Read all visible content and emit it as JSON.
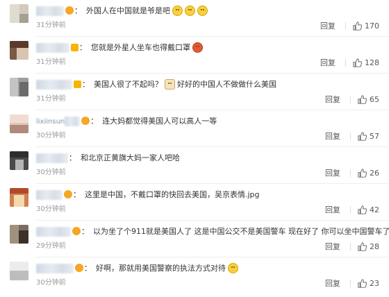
{
  "labels": {
    "reply": "回复"
  },
  "comments": [
    {
      "text": "外国人在中国就是爷是吧",
      "emojis": [
        "smile-emoji",
        "smile-emoji",
        "smile-emoji"
      ],
      "time": "31分钟前",
      "likes": "170",
      "avatar_colors": [
        "#c9c2b4",
        "#e0dbd1",
        "#a79f92"
      ]
    },
    {
      "text": "您就是外星人坐车也得戴口罩",
      "emojis": [
        "mask-emoji"
      ],
      "time": "31分钟前",
      "likes": "128",
      "avatar_colors": [
        "#5a3a2a",
        "#9a6a4a",
        "#d9c4b0"
      ]
    },
    {
      "text": "美国人很了不起吗？",
      "emojis": [
        "cat-emoji"
      ],
      "text2": "好好的中国人不做做什么美国",
      "time": "31分钟前",
      "likes": "65",
      "avatar_colors": [
        "#8e8e8e",
        "#c4c4c4",
        "#6b6b6b"
      ]
    },
    {
      "name_visible": "lixiinsun",
      "text": "连大妈都觉得美国人可以高人一等",
      "time": "30分钟前",
      "likes": "57",
      "avatar_colors": [
        "#d8b7a8",
        "#f0dcd2",
        "#b08a7c"
      ]
    },
    {
      "text": "和北京正黄旗大妈一家人吧哈",
      "time": "30分钟前",
      "likes": "26",
      "avatar_colors": [
        "#2e2e2e",
        "#6a6a6a",
        "#b5b5b5"
      ]
    },
    {
      "text": "这里是中国，不戴口罩的快回去美国，吴京表情.jpg",
      "time": "30分钟前",
      "likes": "42",
      "avatar_colors": [
        "#b24a2a",
        "#e0a070",
        "#f4d8b0"
      ]
    },
    {
      "text": "以为坐了个911就是美国人了 这是中国公交不是美国警车 现在好了 你可以坐中国警车了",
      "time": "29分钟前",
      "likes": "28",
      "avatar_colors": [
        "#6a5a50",
        "#a09080",
        "#3c3028"
      ]
    },
    {
      "text": "好啊，那就用美国警察的执法方式对待",
      "emojis": [
        "laugh-emoji"
      ],
      "time": "30分钟前",
      "likes": "23",
      "avatar_colors": [
        "#d6d6d6",
        "#ececec",
        "#bdbdbd"
      ]
    }
  ]
}
